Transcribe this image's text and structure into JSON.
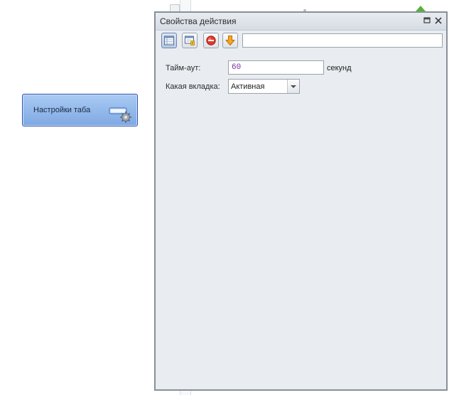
{
  "node": {
    "label": "Настройки таба",
    "icon": "tab-settings-gear-icon"
  },
  "panel": {
    "title": "Свойства действия",
    "title_buttons": [
      "maximize-icon",
      "close-icon"
    ],
    "toolbar": {
      "buttons": [
        "properties-grid-icon",
        "window-settings-icon",
        "stop-icon",
        "down-arrow-icon"
      ],
      "search_value": ""
    },
    "form": {
      "timeout_label": "Тайм-аут:",
      "timeout_value": "60",
      "timeout_unit": "секунд",
      "tab_label": "Какая вкладка:",
      "tab_selected": "Активная"
    }
  },
  "colors": {
    "node_border": "#2e50a8",
    "node_fill": "#94b9ec",
    "panel_bg": "#e9ecf0",
    "value_text": "#7b2aa3",
    "marker_green": "#56b23a"
  }
}
